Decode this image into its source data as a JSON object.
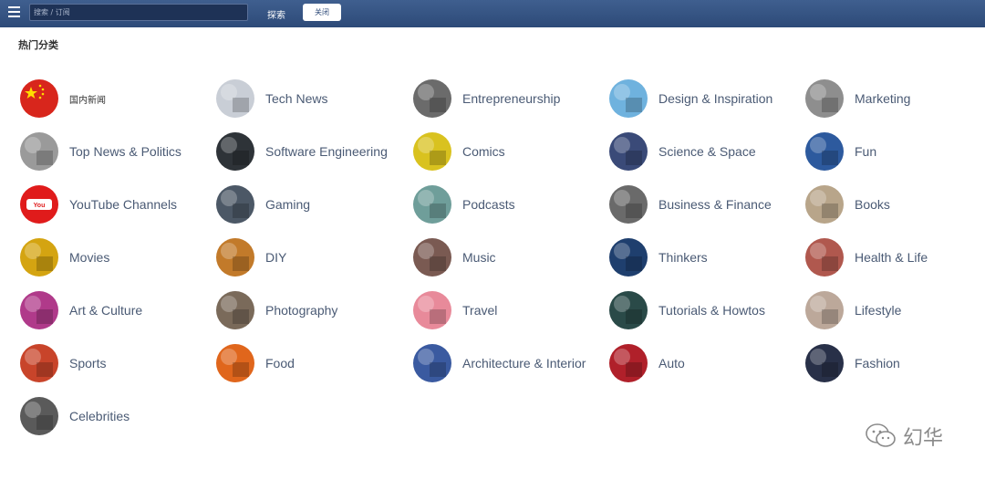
{
  "header": {
    "search_placeholder": "搜索 / 订阅",
    "search_button": "探索",
    "close_button": "关闭"
  },
  "section_title": "热门分类",
  "categories": [
    {
      "label": "国内新闻",
      "icon": "china-flag-icon",
      "color": "#d8261c"
    },
    {
      "label": "Tech News",
      "icon": "robot-icon",
      "color": "#c9ced6"
    },
    {
      "label": "Entrepreneurship",
      "icon": "coffee-mug-icon",
      "color": "#6b6b6b"
    },
    {
      "label": "Design & Inspiration",
      "icon": "light-beam-icon",
      "color": "#6fb2de"
    },
    {
      "label": "Marketing",
      "icon": "storefront-icon",
      "color": "#8e8e8e"
    },
    {
      "label": "Top News & Politics",
      "icon": "newspaper-icon",
      "color": "#9a9a9a"
    },
    {
      "label": "Software Engineering",
      "icon": "code-screen-icon",
      "color": "#2e3338"
    },
    {
      "label": "Comics",
      "icon": "comic-icon",
      "color": "#d9c21f"
    },
    {
      "label": "Science & Space",
      "icon": "telescope-icon",
      "color": "#3a4a78"
    },
    {
      "label": "Fun",
      "icon": "fun-face-icon",
      "color": "#2d5a9e"
    },
    {
      "label": "YouTube Channels",
      "icon": "youtube-icon",
      "color": "#e01b1b"
    },
    {
      "label": "Gaming",
      "icon": "gamepad-icon",
      "color": "#4c5866"
    },
    {
      "label": "Podcasts",
      "icon": "microphone-icon",
      "color": "#6f9e9a"
    },
    {
      "label": "Business & Finance",
      "icon": "business-icon",
      "color": "#6a6a6a"
    },
    {
      "label": "Books",
      "icon": "book-icon",
      "color": "#b8a58a"
    },
    {
      "label": "Movies",
      "icon": "film-reel-icon",
      "color": "#d4a411"
    },
    {
      "label": "DIY",
      "icon": "tools-icon",
      "color": "#c27a2a"
    },
    {
      "label": "Music",
      "icon": "headphones-icon",
      "color": "#7a5a52"
    },
    {
      "label": "Thinkers",
      "icon": "statue-icon",
      "color": "#1f3f6e"
    },
    {
      "label": "Health & Life",
      "icon": "health-icon",
      "color": "#b0584e"
    },
    {
      "label": "Art & Culture",
      "icon": "art-icon",
      "color": "#b03a8a"
    },
    {
      "label": "Photography",
      "icon": "camera-icon",
      "color": "#7a6a5a"
    },
    {
      "label": "Travel",
      "icon": "travel-icon",
      "color": "#e88a9a"
    },
    {
      "label": "Tutorials & Howtos",
      "icon": "tutorial-icon",
      "color": "#2a4a48"
    },
    {
      "label": "Lifestyle",
      "icon": "lifestyle-icon",
      "color": "#bca89a"
    },
    {
      "label": "Sports",
      "icon": "ball-icon",
      "color": "#c8442a"
    },
    {
      "label": "Food",
      "icon": "carrot-icon",
      "color": "#e0661c"
    },
    {
      "label": "Architecture & Interior",
      "icon": "building-icon",
      "color": "#3a5aa0"
    },
    {
      "label": "Auto",
      "icon": "car-icon",
      "color": "#b0202a"
    },
    {
      "label": "Fashion",
      "icon": "fashion-icon",
      "color": "#283048"
    },
    {
      "label": "Celebrities",
      "icon": "celebrity-icon",
      "color": "#5a5a5a"
    }
  ],
  "watermark": {
    "text": "幻华",
    "icon": "wechat-icon"
  }
}
